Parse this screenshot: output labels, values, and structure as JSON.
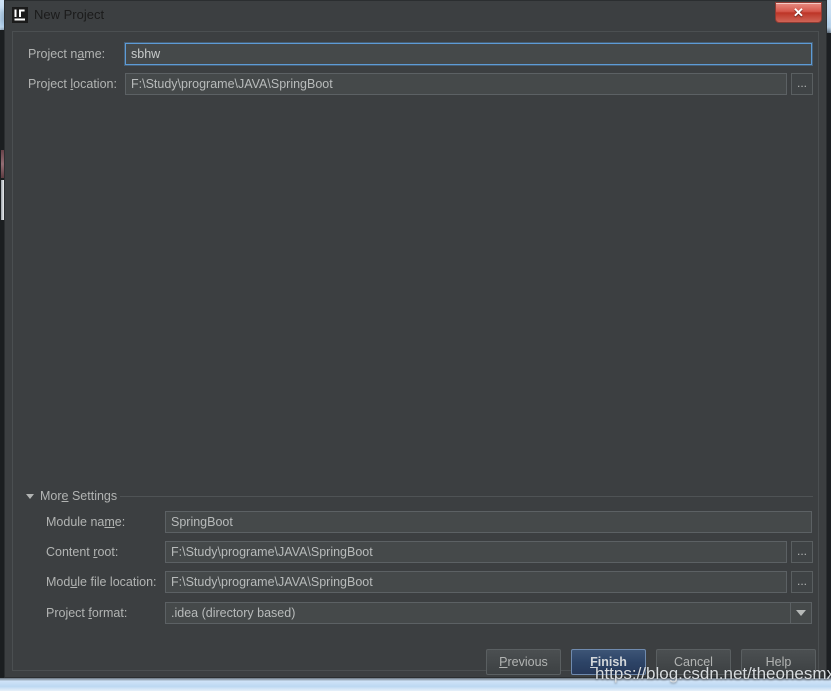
{
  "window": {
    "title": "New Project",
    "icon": "intellij-idea-icon",
    "close_label": "✕"
  },
  "main_fields": [
    {
      "label_pre": "Project n",
      "label_mnemonic": "a",
      "label_post": "me:",
      "value": "sbhw",
      "focused": true,
      "has_browse": false,
      "name": "project-name"
    },
    {
      "label_pre": "Project ",
      "label_mnemonic": "l",
      "label_post": "ocation:",
      "value": "F:\\Study\\programe\\JAVA\\SpringBoot",
      "focused": false,
      "has_browse": true,
      "name": "project-location"
    }
  ],
  "more_settings": {
    "label_pre": "Mor",
    "label_mnemonic": "e",
    "label_post": " Settings",
    "expanded": true,
    "fields": [
      {
        "label_pre": "Module na",
        "label_mnemonic": "m",
        "label_post": "e:",
        "value": "SpringBoot",
        "has_browse": false,
        "is_combo": false,
        "name": "module-name"
      },
      {
        "label_pre": "Content ",
        "label_mnemonic": "r",
        "label_post": "oot:",
        "value": "F:\\Study\\programe\\JAVA\\SpringBoot",
        "has_browse": true,
        "is_combo": false,
        "name": "content-root"
      },
      {
        "label_pre": "Mod",
        "label_mnemonic": "u",
        "label_post": "le file location:",
        "value": "F:\\Study\\programe\\JAVA\\SpringBoot",
        "has_browse": true,
        "is_combo": false,
        "name": "module-file-location"
      },
      {
        "label_pre": "Project ",
        "label_mnemonic": "f",
        "label_post": "ormat:",
        "value": ".idea (directory based)",
        "has_browse": false,
        "is_combo": true,
        "name": "project-format"
      }
    ]
  },
  "buttons": [
    {
      "label_pre": "",
      "label_mnemonic": "P",
      "label_post": "revious",
      "default": false,
      "name": "previous-button"
    },
    {
      "label_pre": "",
      "label_mnemonic": "F",
      "label_post": "inish",
      "default": true,
      "name": "finish-button"
    },
    {
      "label_pre": "Cancel",
      "label_mnemonic": "",
      "label_post": "",
      "default": false,
      "name": "cancel-button"
    },
    {
      "label_pre": "Help",
      "label_mnemonic": "",
      "label_post": "",
      "default": false,
      "name": "help-button"
    }
  ],
  "watermark": "https://blog.csdn.net/theonesmx",
  "colors": {
    "dialog_bg": "#3c3f41",
    "field_bg": "#45494a",
    "field_border": "#5c6164",
    "focus_border": "#5d9bd6",
    "text": "#b2b4b3",
    "default_button_bg": "#2d4467",
    "close_button_red": "#bd3527",
    "aero_blue": "#bdd7ef"
  }
}
